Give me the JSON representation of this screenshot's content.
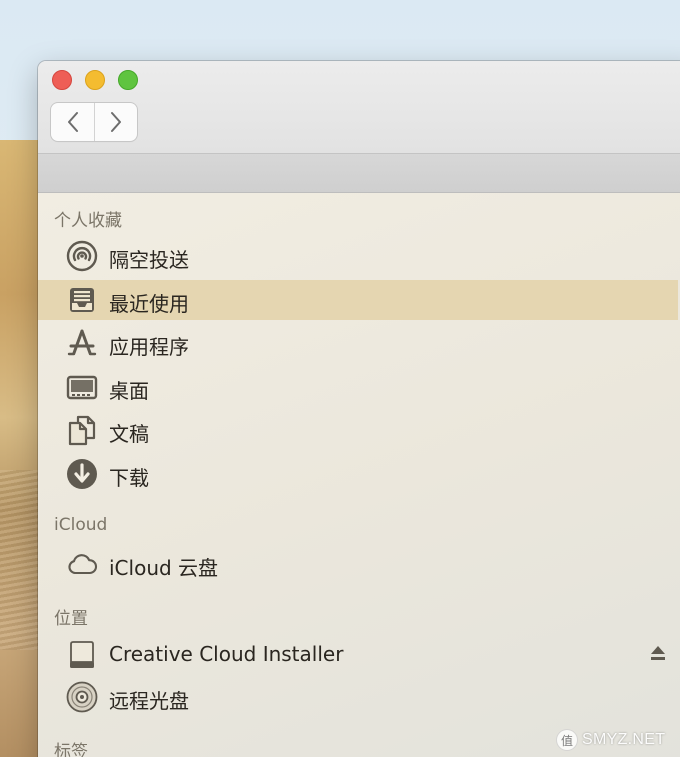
{
  "window": {
    "controls": {
      "close": "close",
      "minimize": "minimize",
      "zoom": "zoom"
    },
    "nav": {
      "back_icon": "chevron-left-icon",
      "forward_icon": "chevron-right-icon"
    }
  },
  "sidebar": {
    "favorites": {
      "title": "个人收藏",
      "items": [
        {
          "label": "隔空投送",
          "icon": "airdrop-icon"
        },
        {
          "label": "最近使用",
          "icon": "recents-icon",
          "selected": true
        },
        {
          "label": "应用程序",
          "icon": "applications-icon"
        },
        {
          "label": "桌面",
          "icon": "desktop-icon"
        },
        {
          "label": "文稿",
          "icon": "documents-icon"
        },
        {
          "label": "下载",
          "icon": "downloads-icon"
        }
      ]
    },
    "icloud": {
      "title": "iCloud",
      "items": [
        {
          "label": "iCloud 云盘",
          "icon": "cloud-icon"
        }
      ]
    },
    "locations": {
      "title": "位置",
      "items": [
        {
          "label": "Creative Cloud Installer",
          "icon": "drive-icon",
          "eject_icon": "eject-icon"
        },
        {
          "label": "远程光盘",
          "icon": "optical-disc-icon"
        }
      ]
    },
    "tags": {
      "title": "标签"
    }
  },
  "watermark": {
    "text": "SMYZ.NET"
  },
  "colors": {
    "selection": "#e5d6b1",
    "icon": "#5f5a50",
    "close": "#ee5e56",
    "minimize": "#f4bc30",
    "zoom": "#5fc43f"
  }
}
